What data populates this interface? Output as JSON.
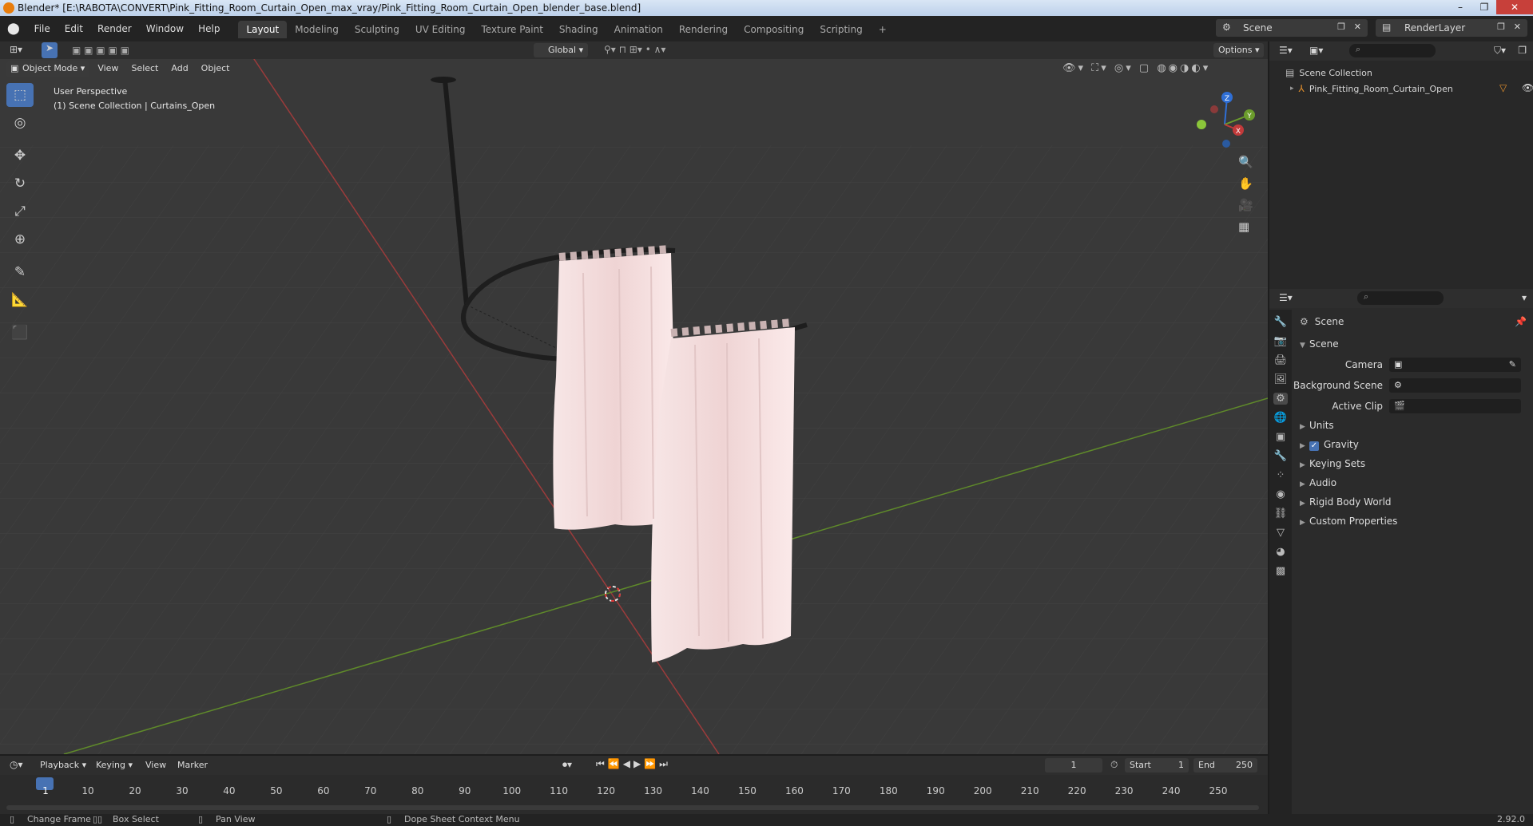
{
  "window": {
    "title": "Blender* [E:\\RABOTA\\CONVERT\\Pink_Fitting_Room_Curtain_Open_max_vray/Pink_Fitting_Room_Curtain_Open_blender_base.blend]",
    "min": "–",
    "max": "❐",
    "close": "✕"
  },
  "menu": [
    "File",
    "Edit",
    "Render",
    "Window",
    "Help"
  ],
  "workspaces": [
    "Layout",
    "Modeling",
    "Sculpting",
    "UV Editing",
    "Texture Paint",
    "Shading",
    "Animation",
    "Rendering",
    "Compositing",
    "Scripting",
    "+"
  ],
  "scene_selector": "Scene",
  "renderlayer_selector": "RenderLayer",
  "viewport": {
    "transform_orientation": "Global",
    "options": "Options",
    "mode": "Object Mode",
    "header_menus": [
      "View",
      "Select",
      "Add",
      "Object"
    ],
    "overlay_line1": "User Perspective",
    "overlay_line2": "(1) Scene Collection | Curtains_Open",
    "gizmo": {
      "z": "Z",
      "y": "Y",
      "x": "X"
    }
  },
  "outliner": {
    "root": "Scene Collection",
    "items": [
      {
        "label": "Pink_Fitting_Room_Curtain_Open"
      }
    ]
  },
  "properties": {
    "title": "Scene",
    "section": "Scene",
    "fields": [
      {
        "label": "Camera",
        "value": ""
      },
      {
        "label": "Background Scene",
        "value": ""
      },
      {
        "label": "Active Clip",
        "value": ""
      }
    ],
    "panels": [
      "Units",
      "Gravity",
      "Keying Sets",
      "Audio",
      "Rigid Body World",
      "Custom Properties"
    ],
    "gravity_checked": true
  },
  "timeline": {
    "menus": [
      "Playback",
      "Keying",
      "View",
      "Marker"
    ],
    "current_frame": "1",
    "start_label": "Start",
    "start": "1",
    "end_label": "End",
    "end": "250",
    "ticks": [
      "1",
      "10",
      "20",
      "30",
      "40",
      "50",
      "60",
      "70",
      "80",
      "90",
      "100",
      "110",
      "120",
      "130",
      "140",
      "150",
      "160",
      "170",
      "180",
      "190",
      "200",
      "210",
      "220",
      "230",
      "240",
      "250"
    ]
  },
  "statusbar": {
    "items": [
      "Change Frame",
      "Box Select",
      "Pan View",
      "Dope Sheet Context Menu"
    ],
    "version": "2.92.0"
  },
  "colors": {
    "accent": "#4772b3",
    "curtain": "#f3dede",
    "x_axis": "#c23a3a",
    "y_axis": "#6e9b2a"
  }
}
